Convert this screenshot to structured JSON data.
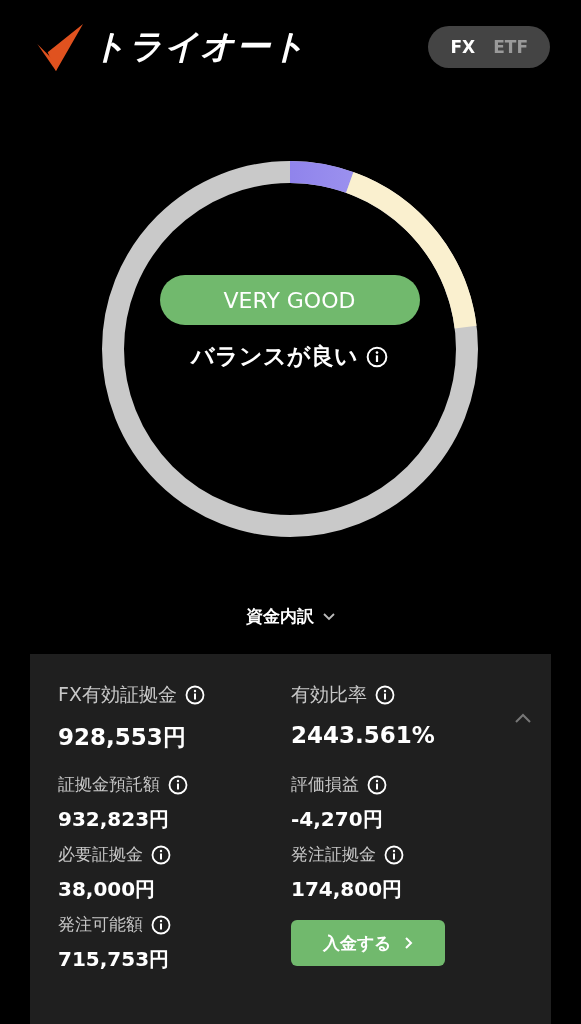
{
  "header": {
    "logo_text": "トライオート",
    "toggle": [
      {
        "label": "FX",
        "selected": true
      },
      {
        "label": "ETF",
        "selected": false
      }
    ]
  },
  "balance": {
    "rating": "VERY GOOD",
    "message": "バランスが良い"
  },
  "breakdown": {
    "label": "資金内訳",
    "expanded": true
  },
  "metrics": [
    {
      "label": "FX有効証拠金",
      "value": "928,553円"
    },
    {
      "label": "有効比率",
      "value": "2443.561%"
    },
    {
      "label": "証拠金預託額",
      "value": "932,823円"
    },
    {
      "label": "評価損益",
      "value": "-4,270円"
    },
    {
      "label": "必要証拠金",
      "value": "38,000円"
    },
    {
      "label": "発注証拠金",
      "value": "174,800円"
    },
    {
      "label": "発注可能額",
      "value": "715,753円"
    }
  ],
  "deposit_button": "入金する"
}
